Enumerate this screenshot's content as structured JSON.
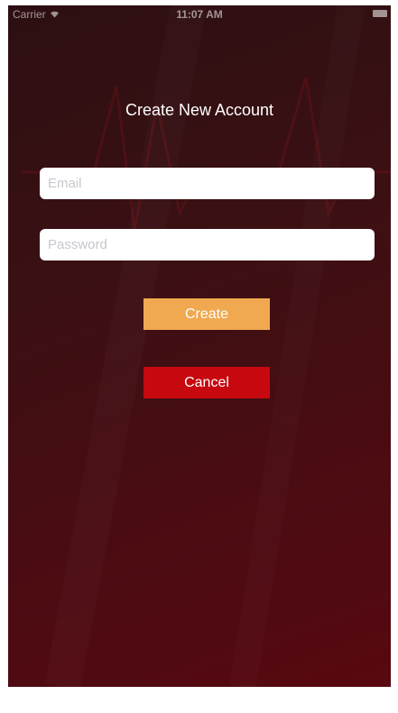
{
  "status_bar": {
    "carrier": "Carrier",
    "wifi_icon": "wifi-icon",
    "time": "11:07 AM",
    "battery_icon": "battery-icon"
  },
  "title": "Create New Account",
  "form": {
    "email_placeholder": "Email",
    "email_value": "",
    "password_placeholder": "Password",
    "password_value": ""
  },
  "buttons": {
    "create_label": "Create",
    "cancel_label": "Cancel"
  },
  "colors": {
    "create_button": "#f0a950",
    "cancel_button": "#c7080f",
    "background_top": "#2c0f12",
    "background_bottom": "#580811"
  }
}
